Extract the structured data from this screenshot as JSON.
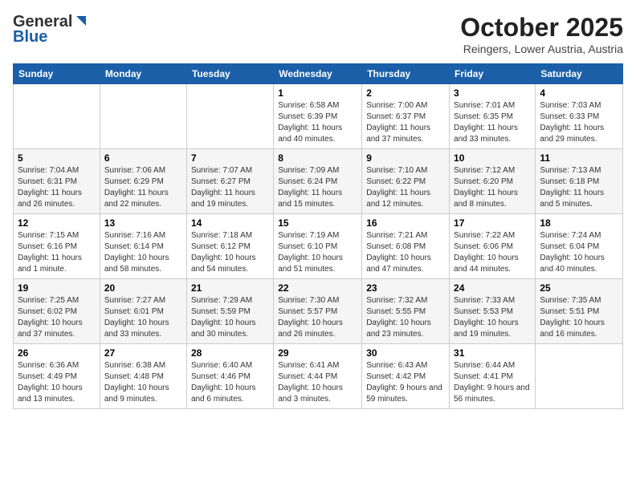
{
  "header": {
    "logo_general": "General",
    "logo_blue": "Blue",
    "month_year": "October 2025",
    "location": "Reingers, Lower Austria, Austria"
  },
  "days_of_week": [
    "Sunday",
    "Monday",
    "Tuesday",
    "Wednesday",
    "Thursday",
    "Friday",
    "Saturday"
  ],
  "weeks": [
    {
      "days": [
        {
          "num": "",
          "info": ""
        },
        {
          "num": "",
          "info": ""
        },
        {
          "num": "",
          "info": ""
        },
        {
          "num": "1",
          "info": "Sunrise: 6:58 AM\nSunset: 6:39 PM\nDaylight: 11 hours and 40 minutes."
        },
        {
          "num": "2",
          "info": "Sunrise: 7:00 AM\nSunset: 6:37 PM\nDaylight: 11 hours and 37 minutes."
        },
        {
          "num": "3",
          "info": "Sunrise: 7:01 AM\nSunset: 6:35 PM\nDaylight: 11 hours and 33 minutes."
        },
        {
          "num": "4",
          "info": "Sunrise: 7:03 AM\nSunset: 6:33 PM\nDaylight: 11 hours and 29 minutes."
        }
      ]
    },
    {
      "days": [
        {
          "num": "5",
          "info": "Sunrise: 7:04 AM\nSunset: 6:31 PM\nDaylight: 11 hours and 26 minutes."
        },
        {
          "num": "6",
          "info": "Sunrise: 7:06 AM\nSunset: 6:29 PM\nDaylight: 11 hours and 22 minutes."
        },
        {
          "num": "7",
          "info": "Sunrise: 7:07 AM\nSunset: 6:27 PM\nDaylight: 11 hours and 19 minutes."
        },
        {
          "num": "8",
          "info": "Sunrise: 7:09 AM\nSunset: 6:24 PM\nDaylight: 11 hours and 15 minutes."
        },
        {
          "num": "9",
          "info": "Sunrise: 7:10 AM\nSunset: 6:22 PM\nDaylight: 11 hours and 12 minutes."
        },
        {
          "num": "10",
          "info": "Sunrise: 7:12 AM\nSunset: 6:20 PM\nDaylight: 11 hours and 8 minutes."
        },
        {
          "num": "11",
          "info": "Sunrise: 7:13 AM\nSunset: 6:18 PM\nDaylight: 11 hours and 5 minutes."
        }
      ]
    },
    {
      "days": [
        {
          "num": "12",
          "info": "Sunrise: 7:15 AM\nSunset: 6:16 PM\nDaylight: 11 hours and 1 minute."
        },
        {
          "num": "13",
          "info": "Sunrise: 7:16 AM\nSunset: 6:14 PM\nDaylight: 10 hours and 58 minutes."
        },
        {
          "num": "14",
          "info": "Sunrise: 7:18 AM\nSunset: 6:12 PM\nDaylight: 10 hours and 54 minutes."
        },
        {
          "num": "15",
          "info": "Sunrise: 7:19 AM\nSunset: 6:10 PM\nDaylight: 10 hours and 51 minutes."
        },
        {
          "num": "16",
          "info": "Sunrise: 7:21 AM\nSunset: 6:08 PM\nDaylight: 10 hours and 47 minutes."
        },
        {
          "num": "17",
          "info": "Sunrise: 7:22 AM\nSunset: 6:06 PM\nDaylight: 10 hours and 44 minutes."
        },
        {
          "num": "18",
          "info": "Sunrise: 7:24 AM\nSunset: 6:04 PM\nDaylight: 10 hours and 40 minutes."
        }
      ]
    },
    {
      "days": [
        {
          "num": "19",
          "info": "Sunrise: 7:25 AM\nSunset: 6:02 PM\nDaylight: 10 hours and 37 minutes."
        },
        {
          "num": "20",
          "info": "Sunrise: 7:27 AM\nSunset: 6:01 PM\nDaylight: 10 hours and 33 minutes."
        },
        {
          "num": "21",
          "info": "Sunrise: 7:29 AM\nSunset: 5:59 PM\nDaylight: 10 hours and 30 minutes."
        },
        {
          "num": "22",
          "info": "Sunrise: 7:30 AM\nSunset: 5:57 PM\nDaylight: 10 hours and 26 minutes."
        },
        {
          "num": "23",
          "info": "Sunrise: 7:32 AM\nSunset: 5:55 PM\nDaylight: 10 hours and 23 minutes."
        },
        {
          "num": "24",
          "info": "Sunrise: 7:33 AM\nSunset: 5:53 PM\nDaylight: 10 hours and 19 minutes."
        },
        {
          "num": "25",
          "info": "Sunrise: 7:35 AM\nSunset: 5:51 PM\nDaylight: 10 hours and 16 minutes."
        }
      ]
    },
    {
      "days": [
        {
          "num": "26",
          "info": "Sunrise: 6:36 AM\nSunset: 4:49 PM\nDaylight: 10 hours and 13 minutes."
        },
        {
          "num": "27",
          "info": "Sunrise: 6:38 AM\nSunset: 4:48 PM\nDaylight: 10 hours and 9 minutes."
        },
        {
          "num": "28",
          "info": "Sunrise: 6:40 AM\nSunset: 4:46 PM\nDaylight: 10 hours and 6 minutes."
        },
        {
          "num": "29",
          "info": "Sunrise: 6:41 AM\nSunset: 4:44 PM\nDaylight: 10 hours and 3 minutes."
        },
        {
          "num": "30",
          "info": "Sunrise: 6:43 AM\nSunset: 4:42 PM\nDaylight: 9 hours and 59 minutes."
        },
        {
          "num": "31",
          "info": "Sunrise: 6:44 AM\nSunset: 4:41 PM\nDaylight: 9 hours and 56 minutes."
        },
        {
          "num": "",
          "info": ""
        }
      ]
    }
  ]
}
